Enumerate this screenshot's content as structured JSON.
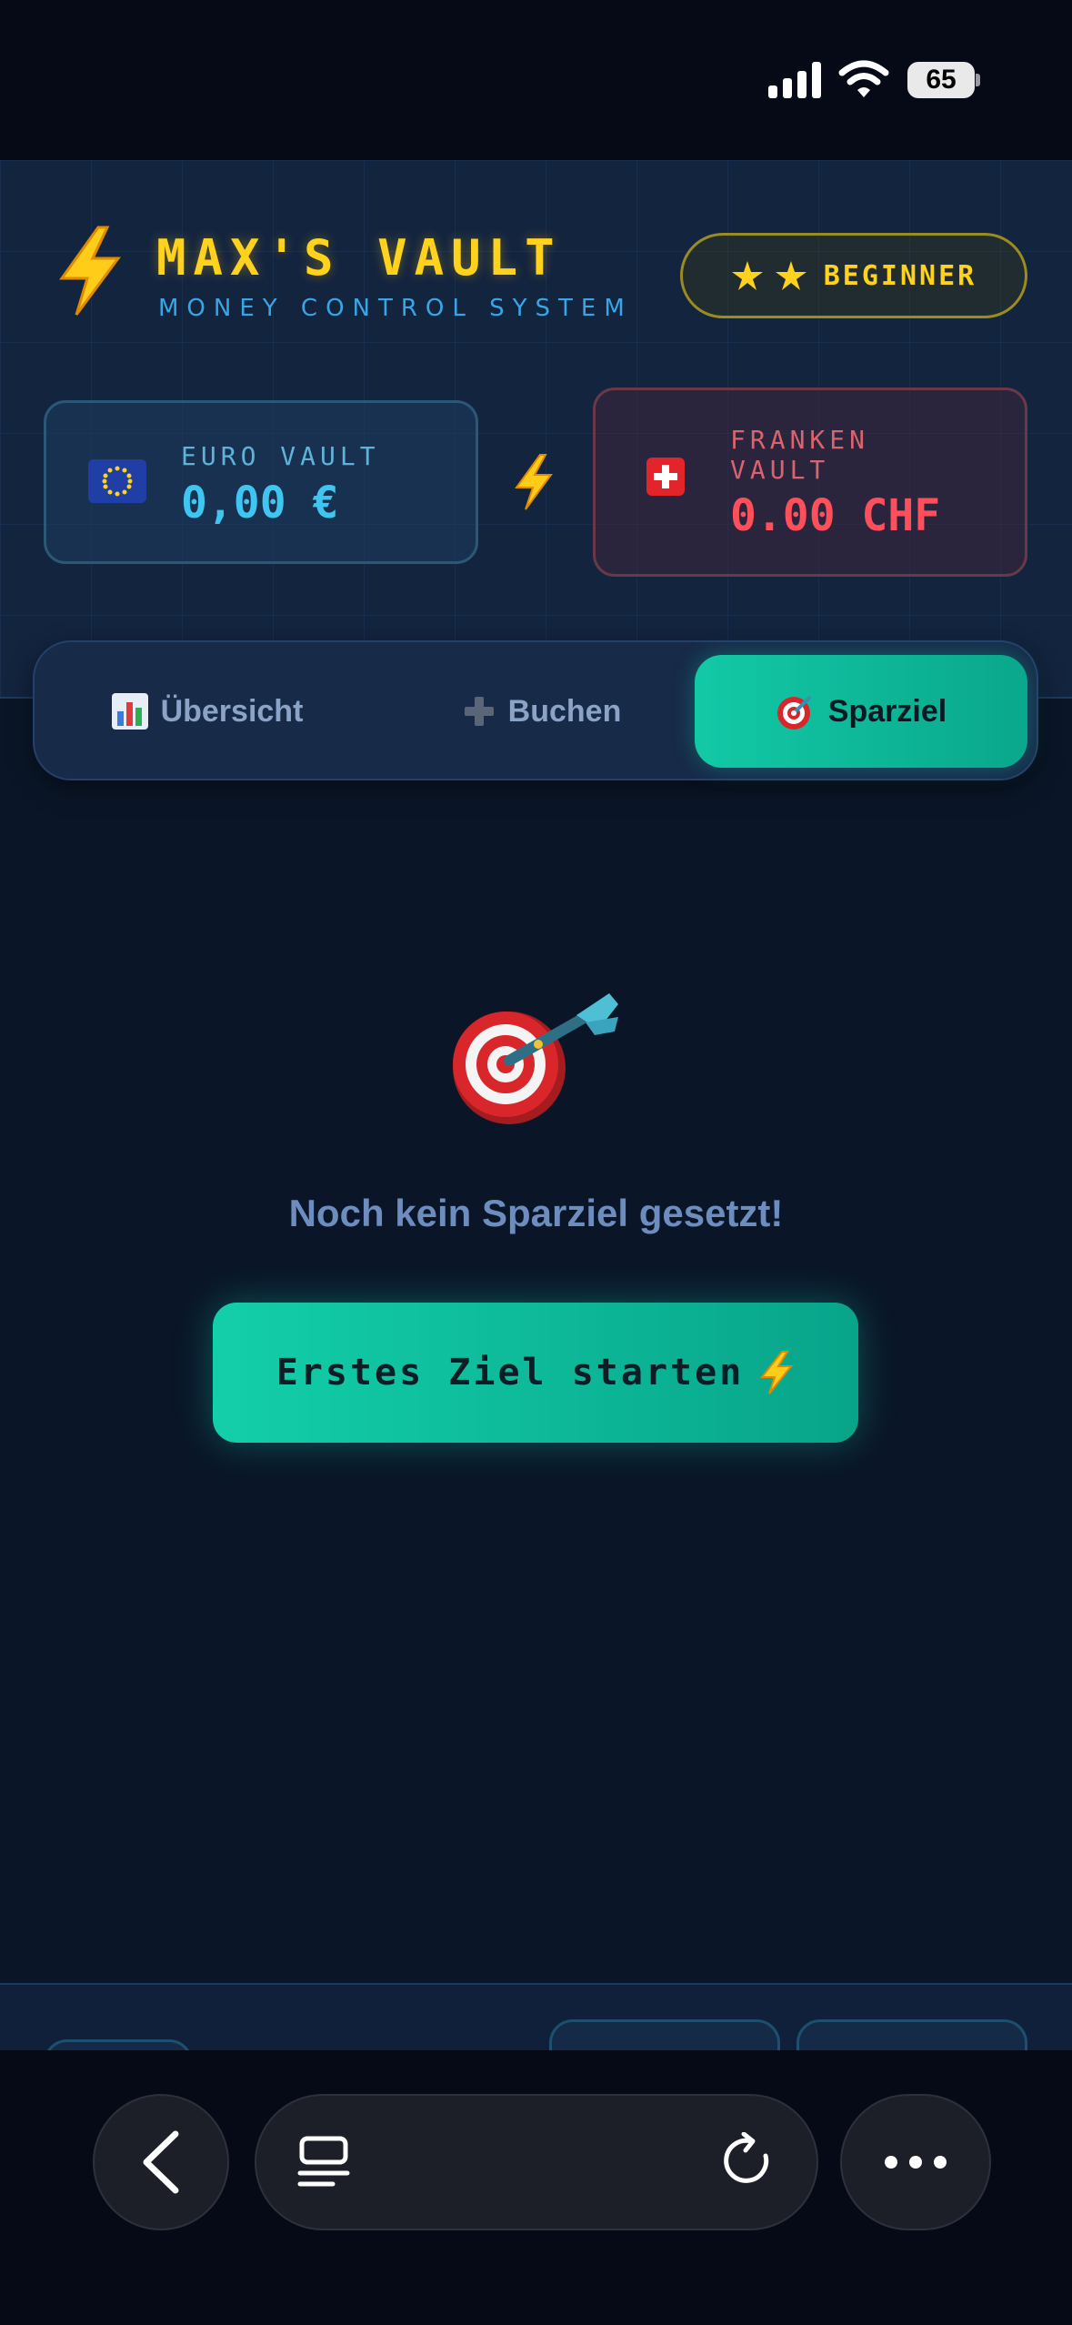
{
  "status_bar": {
    "battery_level": "65"
  },
  "header": {
    "title": "MAX'S VAULT",
    "subtitle": "MONEY CONTROL SYSTEM",
    "level_badge": "BEGINNER"
  },
  "vaults": {
    "eur": {
      "label": "EURO VAULT",
      "value": "0,00 €"
    },
    "chf": {
      "label": "FRANKEN VAULT",
      "value": "0.00 CHF"
    }
  },
  "tabs": [
    {
      "label": "Übersicht",
      "icon": "bar-chart-icon",
      "active": false
    },
    {
      "label": "Buchen",
      "icon": "plus-icon",
      "active": false
    },
    {
      "label": "Sparziel",
      "icon": "target-icon",
      "active": true
    }
  ],
  "main": {
    "empty_message": "Noch kein Sparziel gesetzt!",
    "start_button": "Erstes Ziel starten"
  },
  "colors": {
    "accent_yellow": "#ffd21e",
    "accent_teal": "#12c9a6",
    "euro_blue": "#3fc6f0",
    "franc_red": "#ff4f5b",
    "background": "#0a1628"
  }
}
